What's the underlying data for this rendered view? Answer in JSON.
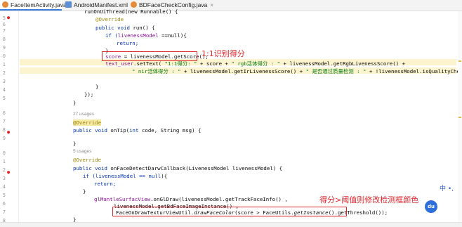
{
  "tabs": [
    {
      "label": "FaceItemActivity.java",
      "type": "java",
      "active": true
    },
    {
      "label": "AndroidManifest.xml",
      "type": "xml",
      "active": false
    },
    {
      "label": "BDFaceCheckConfig.java",
      "type": "java",
      "active": false
    }
  ],
  "gutter": {
    "line_numbers": [
      "5",
      "6",
      "7",
      "8",
      "9",
      "0",
      "1",
      "2",
      "3",
      "4",
      "5",
      "6",
      "7",
      "8",
      "9",
      "0",
      "1",
      "2",
      "3",
      "4",
      "5",
      "6",
      "7",
      "8",
      "9",
      "0",
      "1",
      "2",
      "3",
      "4",
      "5",
      "6",
      "7"
    ]
  },
  "code": {
    "l0_run_on_ui": "runOnUiThread(new Runnable() {",
    "l1_override": "@Override",
    "l2_kw": "public void",
    "l2_rest": " run() {",
    "l3_if": "if (",
    "l3_field": "livenessModel",
    "l3_rest": " ==null){",
    "l4_return": "return;",
    "l5_close": "}",
    "l6_score_var": "score",
    "l6_rest": " = livenessModel.getScore();",
    "l7_text_user": "text_user",
    "l7_settext": ".setText( ",
    "l7_str1": "\"1:1得分: \"",
    "l7_mid": " + score + ",
    "l7_str2": "\" rgb活体得分 : \"",
    "l7_tail": " + livenessModel.getRgbLivenessScore() +",
    "l8_str1": "\" nir活体得分 : \"",
    "l8_mid": " + livenessModel.getIrLivenessScore() + ",
    "l8_str2": "\" 是否通过质量检测 : \"",
    "l8_tail": " + !livenessModel.isQualityCheck());",
    "l10_close": "}",
    "l11_close": "});",
    "l12_close": "}",
    "usages_1": "27 usages",
    "l14_override": "@Override",
    "l15_kw": "public void",
    "l15_rest": " onTip(",
    "l15_int": "int",
    "l15_args": " code, String msg) {",
    "l17_close": "}",
    "usages_2": "5 usages",
    "l19_override": "@Override",
    "l20_kw": "public void",
    "l20_rest": " onFaceDetectDarwCallback(LivenessModel livenessModel) {",
    "l21_if": "if (livenessModel == ",
    "l21_null": "null",
    "l21_rest": "){",
    "l22_return": "return;",
    "l23_close": "}",
    "l24_field": "glMantleSurfacView",
    "l24_rest": ".onGlDraw(livenessModel.getTrackFaceInfo() ,",
    "l25_text": "livenessModel.getBdFaceImageInstance() ,",
    "l26_a": "FaceOnDrawTexturViewUtil.",
    "l26_method": "drawFaceColor",
    "l26_b": "(score > FaceUtils.",
    "l26_c": "getInstance",
    "l26_d": "().getThreshold());",
    "l27_close": "}"
  },
  "annotations": {
    "score_label": "1:1识别得分",
    "threshold_label": "得分>阈值则修改检测框颜色"
  },
  "overlay": {
    "du_badge": "du",
    "ime_indicator": "中 •,"
  },
  "colors": {
    "annotation_red": "#e0262b",
    "keyword_blue": "#0033b3",
    "string_green": "#067d17",
    "annotation_gold": "#9e880d",
    "field_purple": "#871094"
  }
}
